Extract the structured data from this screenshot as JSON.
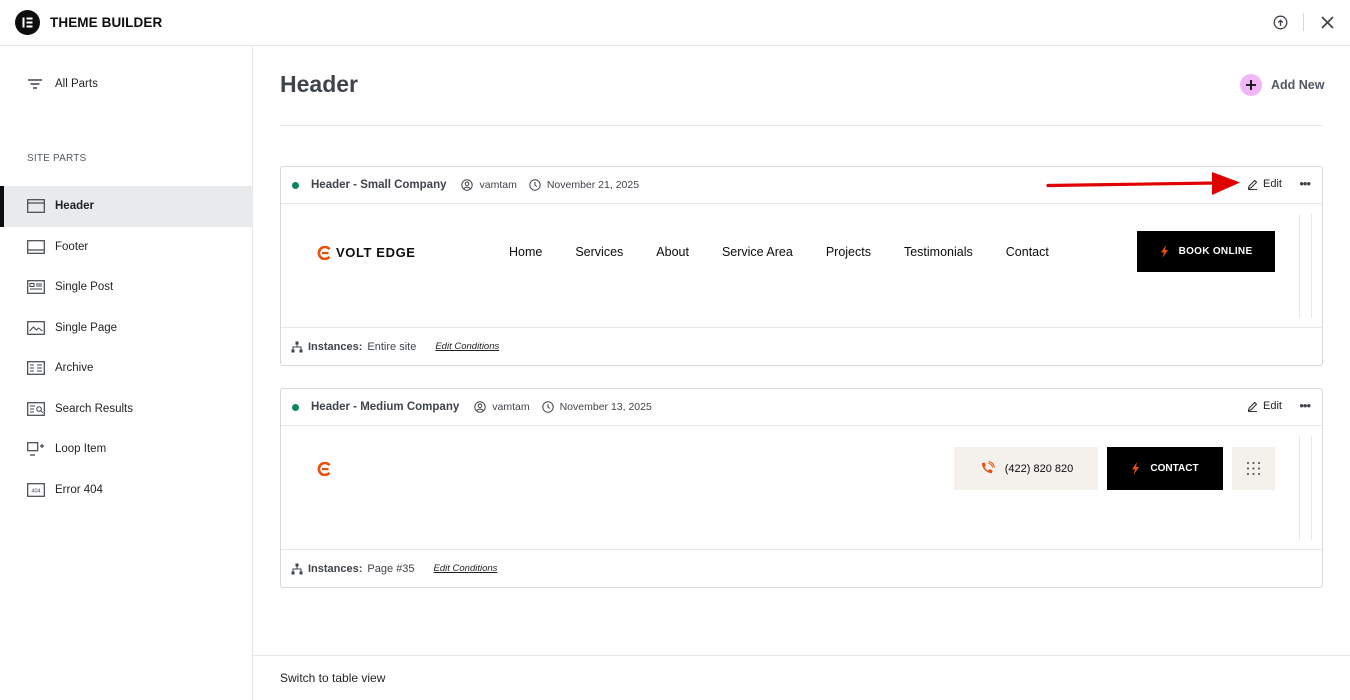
{
  "app": {
    "title": "THEME BUILDER"
  },
  "sidebar": {
    "all_parts": "All Parts",
    "section_label": "SITE PARTS",
    "items": [
      {
        "label": "Header",
        "icon": "header-icon",
        "active": true
      },
      {
        "label": "Footer",
        "icon": "footer-icon"
      },
      {
        "label": "Single Post",
        "icon": "single-post-icon"
      },
      {
        "label": "Single Page",
        "icon": "single-page-icon"
      },
      {
        "label": "Archive",
        "icon": "archive-icon"
      },
      {
        "label": "Search Results",
        "icon": "search-results-icon"
      },
      {
        "label": "Loop Item",
        "icon": "loop-item-icon"
      },
      {
        "label": "Error 404",
        "icon": "error-404-icon"
      }
    ]
  },
  "main": {
    "title": "Header",
    "add_new": "Add New",
    "switch_view": "Switch to table view",
    "cards": [
      {
        "title": "Header - Small Company",
        "author": "vamtam",
        "date": "November 21, 2025",
        "edit": "Edit",
        "instances_label": "Instances:",
        "instances_value": "Entire site",
        "edit_conditions": "Edit Conditions",
        "preview": {
          "brand": "VOLT EDGE",
          "nav": [
            "Home",
            "Services",
            "About",
            "Service Area",
            "Projects",
            "Testimonials",
            "Contact"
          ],
          "cta": "BOOK ONLINE"
        }
      },
      {
        "title": "Header - Medium Company",
        "author": "vamtam",
        "date": "November 13, 2025",
        "edit": "Edit",
        "instances_label": "Instances:",
        "instances_value": "Page #35",
        "edit_conditions": "Edit Conditions",
        "preview": {
          "phone": "(422) 820 820",
          "cta": "CONTACT"
        }
      }
    ]
  },
  "colors": {
    "accent": "#e8500e",
    "status_active": "#0a875a",
    "add_badge": "#f0b6f7",
    "annotation_arrow": "#e00000"
  }
}
